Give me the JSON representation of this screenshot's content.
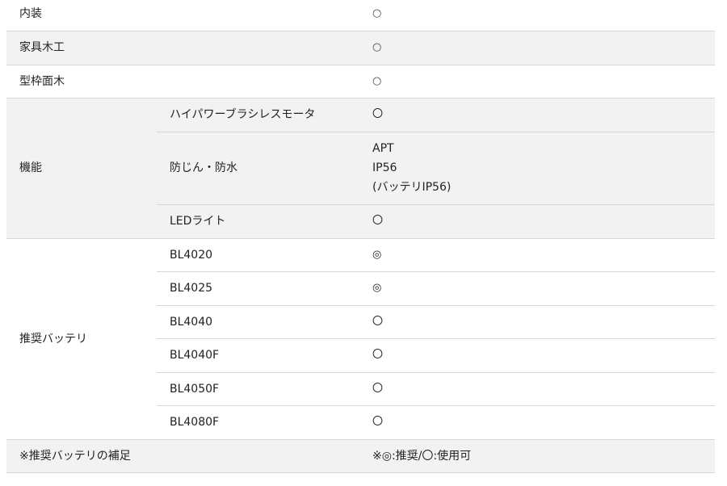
{
  "rows": {
    "naisou": {
      "label": "内装",
      "value": "○"
    },
    "kagu": {
      "label": "家具木工",
      "value": "○"
    },
    "katawaku": {
      "label": "型枠面木",
      "value": "○"
    },
    "kinou": {
      "label": "機能",
      "items": [
        {
          "name": "ハイパワーブラシレスモータ",
          "value": "〇"
        },
        {
          "name": "防じん・防水",
          "value_lines": [
            "APT",
            "IP56",
            "(バッテリIP56)"
          ]
        },
        {
          "name": "LEDライト",
          "value": "〇"
        }
      ]
    },
    "battery": {
      "label": "推奨バッテリ",
      "items": [
        {
          "name": "BL4020",
          "value": "◎"
        },
        {
          "name": "BL4025",
          "value": "◎"
        },
        {
          "name": "BL4040",
          "value": "〇"
        },
        {
          "name": "BL4040F",
          "value": "〇"
        },
        {
          "name": "BL4050F",
          "value": "〇"
        },
        {
          "name": "BL4080F",
          "value": "〇"
        }
      ]
    },
    "note": {
      "label": "※推奨バッテリの補足",
      "value": "※◎:推奨/〇:使用可"
    }
  }
}
